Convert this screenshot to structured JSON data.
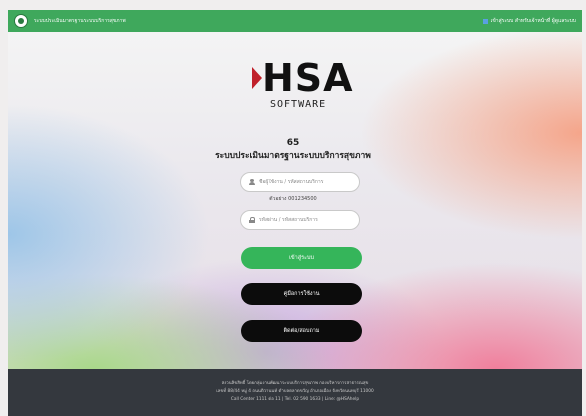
{
  "navbar": {
    "title": "ระบบประเมินมาตรฐานระบบบริการสุขภาพ",
    "right_link": "เข้าสู่ระบบ สำหรับเจ้าหน้าที่ ผู้ดูแลระบบ"
  },
  "logo": {
    "main": "HSA",
    "sub": "SOFTWARE"
  },
  "version": "65",
  "system_title": "ระบบประเมินมาตรฐานระบบบริการสุขภาพ",
  "login": {
    "username_placeholder": "ชื่อผู้ใช้งาน / รหัสสถานบริการ",
    "username_hint": "ตัวอย่าง 001234500",
    "password_placeholder": "รหัสผ่าน / รหัสสถานบริการ",
    "login_label": "เข้าสู่ระบบ",
    "manual_label": "คู่มือการใช้งาน",
    "contact_label": "ติดต่อ/สอบถาม"
  },
  "footer": {
    "line1": "สงวนลิขสิทธิ์ โดยกลุ่มงานพัฒนาระบบบริการสุขภาพ กองบริหารการสาธารณสุข",
    "line2": "เลขที่ 88/44 หมู่ 4 ถนนติวานนท์ ตำบลตลาดขวัญ อำเภอเมือง จังหวัดนนทบุรี 11000",
    "line3": "Call Center 1111 ต่อ 11 | Tel. 02 590 1633 | Line: @HSAhelp"
  },
  "colors": {
    "navbar": "#3fa85c",
    "login_button": "#35b55a",
    "dark_button": "#0c0c0c",
    "footer": "#34383e",
    "logo_mark": "#c0202a"
  }
}
